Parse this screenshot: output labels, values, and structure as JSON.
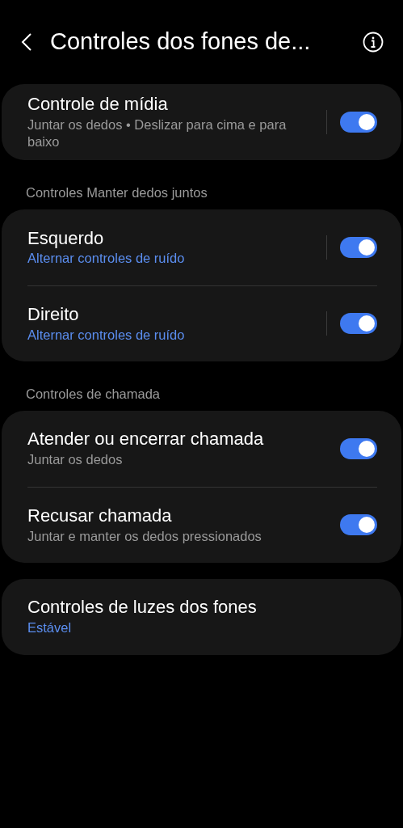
{
  "header": {
    "title": "Controles dos fones de..."
  },
  "groups": [
    {
      "items": [
        {
          "kind": "split_switch",
          "title": "Controle de mídia",
          "subtitle": "Juntar os dedos • Deslizar para cima e para baixo",
          "accent": false,
          "on": true
        }
      ]
    },
    {
      "label": "Controles Manter dedos juntos",
      "items": [
        {
          "kind": "split_switch",
          "title": "Esquerdo",
          "subtitle": "Alternar controles de ruído",
          "accent": true,
          "on": true
        },
        {
          "kind": "split_switch",
          "title": "Direito",
          "subtitle": "Alternar controles de ruído",
          "accent": true,
          "on": true
        }
      ]
    },
    {
      "label": "Controles de chamada",
      "items": [
        {
          "kind": "switch",
          "title": "Atender ou encerrar chamada",
          "subtitle": "Juntar os dedos",
          "accent": false,
          "on": true
        },
        {
          "kind": "switch",
          "title": "Recusar chamada",
          "subtitle": "Juntar e manter os dedos pressionados",
          "accent": false,
          "on": true
        }
      ]
    },
    {
      "items": [
        {
          "kind": "plain",
          "title": "Controles de luzes dos fones",
          "subtitle": "Estável",
          "accent": true
        }
      ]
    }
  ]
}
